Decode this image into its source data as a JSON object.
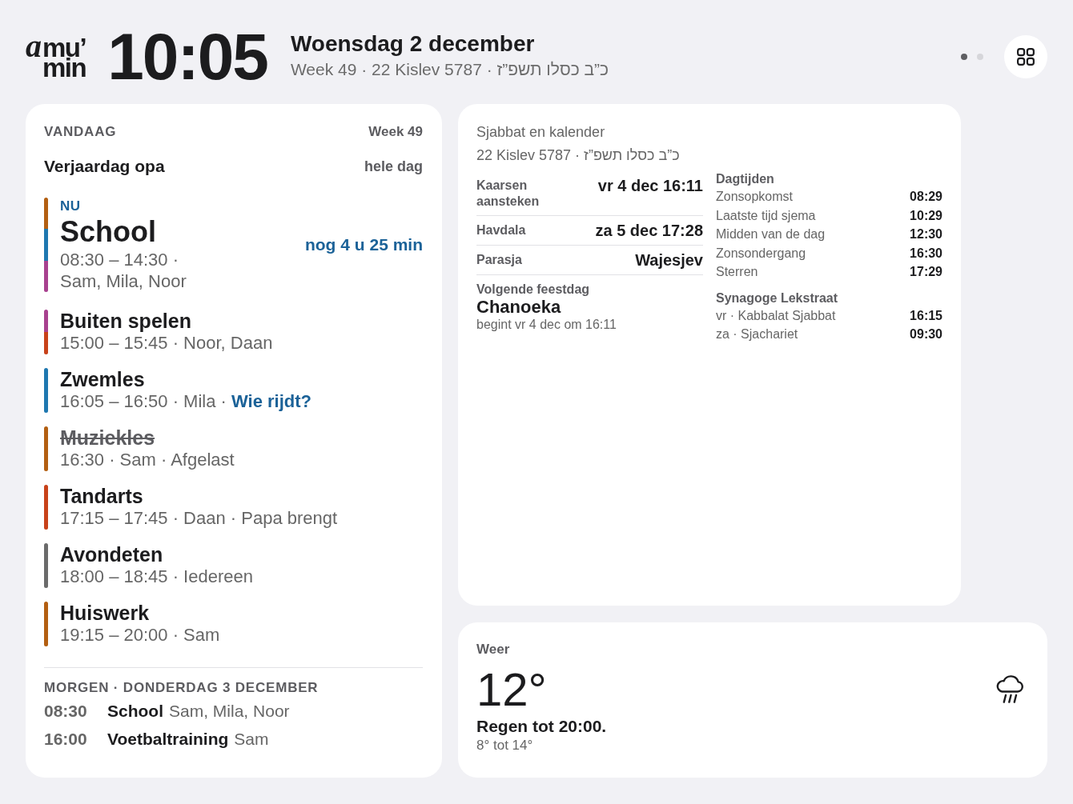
{
  "header": {
    "logo": {
      "mark": "a",
      "line_1": "mu’",
      "line_2": "min"
    },
    "clock": "10:05",
    "date": "Woensdag 2 december",
    "subtitle": "Week 49 · 22 Kislev 5787 · כ”ב כסלו תשפ”ז",
    "page_dots": [
      {
        "selected": true
      },
      {
        "selected": false
      }
    ]
  },
  "today": {
    "heading": "VANDAAG",
    "week": "Week 49",
    "all_day": [
      {
        "title": "Verjaardag opa",
        "when": "hele dag"
      }
    ],
    "events": [
      {
        "title": "School",
        "details": "08:30 – 14:30 · Sam, Mila, Noor",
        "segments": [
          {
            "color": "#b35f12"
          },
          {
            "color": "#1f78b0"
          },
          {
            "color": "#a8418f"
          }
        ],
        "now": true,
        "now_label": "NU",
        "countdown": "nog 4 u 25 min",
        "cancelled": false
      },
      {
        "title": "Buiten spelen",
        "details": "15:00 – 15:45 · Noor, Daan",
        "segments": [
          {
            "color": "#a8418f"
          },
          {
            "color": "#c8421a"
          }
        ],
        "now": false,
        "cancelled": false
      },
      {
        "title": "Zwemles",
        "details": "16:05 – 16:50 · Mila ·",
        "link": "Wie rijdt?",
        "segments": [
          {
            "color": "#1f78b0"
          }
        ],
        "now": false,
        "cancelled": false
      },
      {
        "title": "Muziekles",
        "details": "16:30 · Sam · Afgelast",
        "segments": [
          {
            "color": "#b35f12"
          }
        ],
        "now": false,
        "cancelled": true
      },
      {
        "title": "Tandarts",
        "details": "17:15 – 17:45 · Daan · Papa brengt",
        "segments": [
          {
            "color": "#c8421a"
          }
        ],
        "now": false,
        "cancelled": false
      },
      {
        "title": "Avondeten",
        "details": "18:00 – 18:45 · Iedereen",
        "segments": [
          {
            "color": "#6b6b6b"
          }
        ],
        "now": false,
        "cancelled": false
      },
      {
        "title": "Huiswerk",
        "details": "19:15 – 20:00 · Sam",
        "segments": [
          {
            "color": "#b35f12"
          }
        ],
        "now": false,
        "cancelled": false
      }
    ]
  },
  "tomorrow": {
    "heading": "MORGEN · DONDERDAG 3 DECEMBER",
    "items": [
      {
        "time": "08:30",
        "title": "School",
        "people": "Sam, Mila, Noor"
      },
      {
        "time": "16:00",
        "title": "Voetbaltraining",
        "people": "Sam"
      }
    ]
  },
  "shabbat": {
    "title": "Sjabbat en kalender",
    "date": "22 Kislev 5787 · כ”ב כסלו תשפ”ז",
    "times": [
      {
        "label": "Kaarsen aansteken",
        "value": "vr 4 dec 16:11"
      },
      {
        "label": "Havdala",
        "value": "za 5 dec 17:28"
      },
      {
        "label": "Parasja",
        "value": "Wajesjev"
      }
    ],
    "next_holiday": {
      "label": "Volgende feestdag",
      "name": "Chanoeka",
      "detail": "begint vr 4 dec om 16:11"
    },
    "day_times": {
      "heading": "Dagtijden",
      "rows": [
        {
          "label": "Zonsopkomst",
          "time": "08:29"
        },
        {
          "label": "Laatste tijd sjema",
          "time": "10:29"
        },
        {
          "label": "Midden van de dag",
          "time": "12:30"
        },
        {
          "label": "Zonsondergang",
          "time": "16:30"
        },
        {
          "label": "Sterren",
          "time": "17:29"
        }
      ]
    },
    "synagogue": {
      "heading": "Synagoge Lekstraat",
      "rows": [
        {
          "label": "vr · Kabbalat Sjabbat",
          "time": "16:15"
        },
        {
          "label": "za · Sjachariet",
          "time": "09:30"
        }
      ]
    }
  },
  "weather": {
    "title": "Weer",
    "temperature": "12°",
    "summary": "Regen tot 20:00.",
    "range": "8° tot 14°"
  }
}
